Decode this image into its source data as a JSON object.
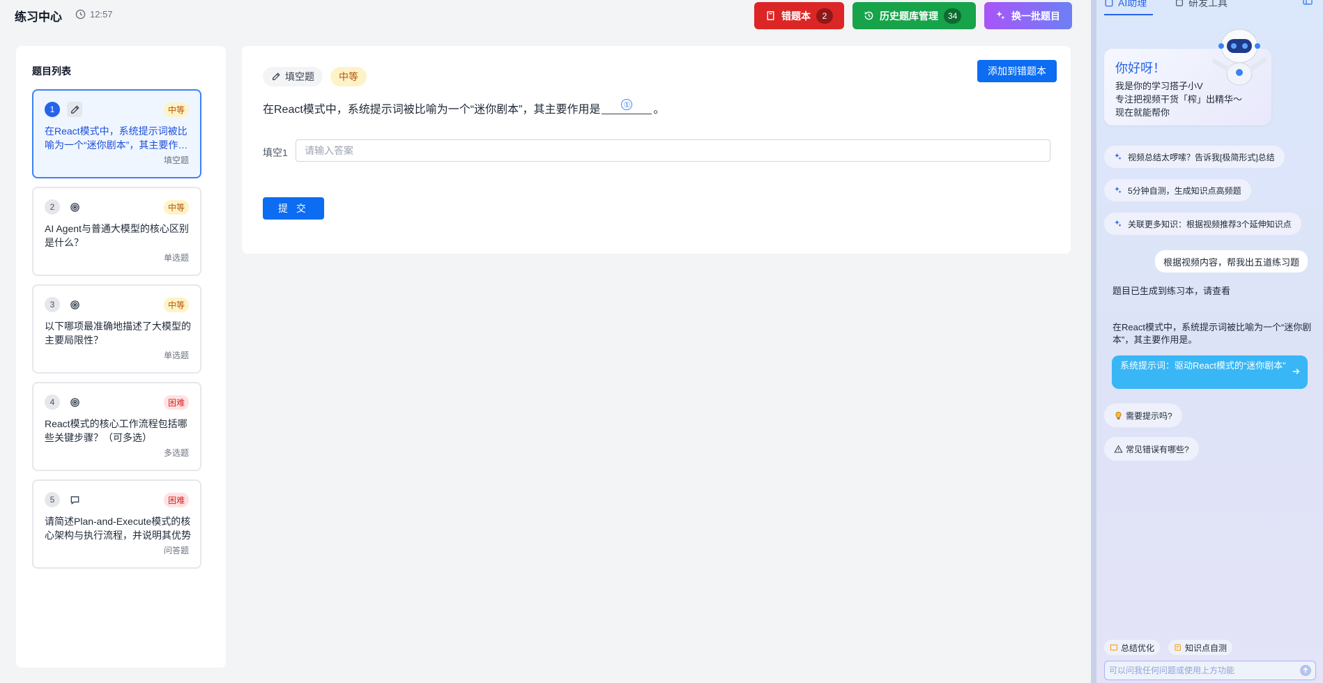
{
  "header": {
    "title": "练习中心",
    "time": "12:57",
    "wrong_book": {
      "label": "错题本",
      "count": "2"
    },
    "history": {
      "label": "历史题库管理",
      "count": "34"
    },
    "refresh": {
      "label": "换一批题目"
    }
  },
  "question_list": {
    "title": "题目列表",
    "items": [
      {
        "num": "1",
        "icon": "pencil-icon",
        "difficulty": "中等",
        "text": "在React模式中，系统提示词被比喻为一个“迷你剧本”，其主要作用是什么？",
        "type": "填空题"
      },
      {
        "num": "2",
        "icon": "target-icon",
        "difficulty": "中等",
        "text": "AI Agent与普通大模型的核心区别是什么？",
        "type": "单选题"
      },
      {
        "num": "3",
        "icon": "target-icon",
        "difficulty": "中等",
        "text": "以下哪项最准确地描述了大模型的主要局限性？",
        "type": "单选题"
      },
      {
        "num": "4",
        "icon": "target-icon",
        "difficulty": "困难",
        "text": "React模式的核心工作流程包括哪些关键步骤？（可多选）",
        "type": "多选题"
      },
      {
        "num": "5",
        "icon": "chat-bubble-icon",
        "difficulty": "困难",
        "text": "请简述Plan-and-Execute模式的核心架构与执行流程，并说明其优势",
        "type": "问答题"
      }
    ]
  },
  "main": {
    "type_tag": "填空题",
    "difficulty_tag": "中等",
    "add_wrong_label": "添加到错题本",
    "stem_before": "在React模式中，系统提示词被比喻为一个“迷你剧本”，其主要作用是",
    "blank_marker": "①",
    "stem_after": "。",
    "fill_label": "填空1",
    "fill_placeholder": "请输入答案",
    "fill_value": "",
    "submit_label": "提 交"
  },
  "assistant": {
    "tab_ai": "AI助理",
    "tab_tools": "研发工具",
    "greet_title": "你好呀！",
    "greet_line1": "我是你的学习搭子小V",
    "greet_line2": "专注把视频干货「榨」出精华～",
    "greet_line3": "现在就能帮你",
    "chips": [
      "视频总结太啰嗦？告诉我[极简形式]总结",
      "5分钟自测，生成知识点高频题",
      "关联更多知识：根据视频推荐3个延伸知识点"
    ],
    "user_message": "根据视频内容，帮我出五道练习题",
    "bot_reply": "题目已生成到练习本，请查看",
    "bot_question": "在React模式中，系统提示词被比喻为一个“迷你剧本”，其主要作用是。",
    "answer_link": "系统提示词：驱动React模式的“迷你剧本”",
    "hint1": "需要提示吗?",
    "hint2": "常见错误有哪些?",
    "tool1": "总结优化",
    "tool2": "知识点自测",
    "input_placeholder": "可以问我任何问题或使用上方功能"
  },
  "colors": {
    "primary": "#0c6cf2",
    "wrong_book": "#dc2626",
    "history": "#16a34a",
    "difficulty_mid": "#fef3c7",
    "difficulty_hard": "#fee2e2"
  }
}
